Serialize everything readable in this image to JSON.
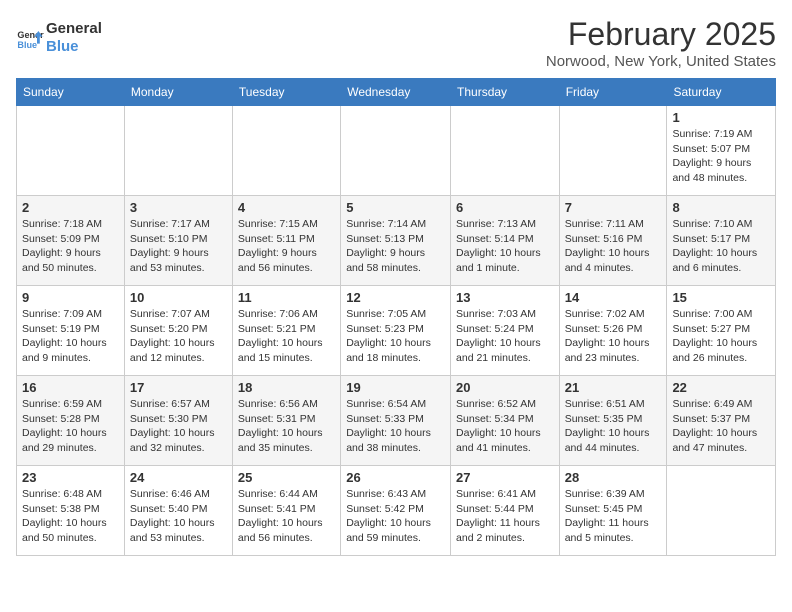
{
  "header": {
    "logo_text_general": "General",
    "logo_text_blue": "Blue",
    "main_title": "February 2025",
    "subtitle": "Norwood, New York, United States"
  },
  "days_of_week": [
    "Sunday",
    "Monday",
    "Tuesday",
    "Wednesday",
    "Thursday",
    "Friday",
    "Saturday"
  ],
  "weeks": [
    [
      {
        "day": "",
        "info": ""
      },
      {
        "day": "",
        "info": ""
      },
      {
        "day": "",
        "info": ""
      },
      {
        "day": "",
        "info": ""
      },
      {
        "day": "",
        "info": ""
      },
      {
        "day": "",
        "info": ""
      },
      {
        "day": "1",
        "info": "Sunrise: 7:19 AM\nSunset: 5:07 PM\nDaylight: 9 hours and 48 minutes."
      }
    ],
    [
      {
        "day": "2",
        "info": "Sunrise: 7:18 AM\nSunset: 5:09 PM\nDaylight: 9 hours and 50 minutes."
      },
      {
        "day": "3",
        "info": "Sunrise: 7:17 AM\nSunset: 5:10 PM\nDaylight: 9 hours and 53 minutes."
      },
      {
        "day": "4",
        "info": "Sunrise: 7:15 AM\nSunset: 5:11 PM\nDaylight: 9 hours and 56 minutes."
      },
      {
        "day": "5",
        "info": "Sunrise: 7:14 AM\nSunset: 5:13 PM\nDaylight: 9 hours and 58 minutes."
      },
      {
        "day": "6",
        "info": "Sunrise: 7:13 AM\nSunset: 5:14 PM\nDaylight: 10 hours and 1 minute."
      },
      {
        "day": "7",
        "info": "Sunrise: 7:11 AM\nSunset: 5:16 PM\nDaylight: 10 hours and 4 minutes."
      },
      {
        "day": "8",
        "info": "Sunrise: 7:10 AM\nSunset: 5:17 PM\nDaylight: 10 hours and 6 minutes."
      }
    ],
    [
      {
        "day": "9",
        "info": "Sunrise: 7:09 AM\nSunset: 5:19 PM\nDaylight: 10 hours and 9 minutes."
      },
      {
        "day": "10",
        "info": "Sunrise: 7:07 AM\nSunset: 5:20 PM\nDaylight: 10 hours and 12 minutes."
      },
      {
        "day": "11",
        "info": "Sunrise: 7:06 AM\nSunset: 5:21 PM\nDaylight: 10 hours and 15 minutes."
      },
      {
        "day": "12",
        "info": "Sunrise: 7:05 AM\nSunset: 5:23 PM\nDaylight: 10 hours and 18 minutes."
      },
      {
        "day": "13",
        "info": "Sunrise: 7:03 AM\nSunset: 5:24 PM\nDaylight: 10 hours and 21 minutes."
      },
      {
        "day": "14",
        "info": "Sunrise: 7:02 AM\nSunset: 5:26 PM\nDaylight: 10 hours and 23 minutes."
      },
      {
        "day": "15",
        "info": "Sunrise: 7:00 AM\nSunset: 5:27 PM\nDaylight: 10 hours and 26 minutes."
      }
    ],
    [
      {
        "day": "16",
        "info": "Sunrise: 6:59 AM\nSunset: 5:28 PM\nDaylight: 10 hours and 29 minutes."
      },
      {
        "day": "17",
        "info": "Sunrise: 6:57 AM\nSunset: 5:30 PM\nDaylight: 10 hours and 32 minutes."
      },
      {
        "day": "18",
        "info": "Sunrise: 6:56 AM\nSunset: 5:31 PM\nDaylight: 10 hours and 35 minutes."
      },
      {
        "day": "19",
        "info": "Sunrise: 6:54 AM\nSunset: 5:33 PM\nDaylight: 10 hours and 38 minutes."
      },
      {
        "day": "20",
        "info": "Sunrise: 6:52 AM\nSunset: 5:34 PM\nDaylight: 10 hours and 41 minutes."
      },
      {
        "day": "21",
        "info": "Sunrise: 6:51 AM\nSunset: 5:35 PM\nDaylight: 10 hours and 44 minutes."
      },
      {
        "day": "22",
        "info": "Sunrise: 6:49 AM\nSunset: 5:37 PM\nDaylight: 10 hours and 47 minutes."
      }
    ],
    [
      {
        "day": "23",
        "info": "Sunrise: 6:48 AM\nSunset: 5:38 PM\nDaylight: 10 hours and 50 minutes."
      },
      {
        "day": "24",
        "info": "Sunrise: 6:46 AM\nSunset: 5:40 PM\nDaylight: 10 hours and 53 minutes."
      },
      {
        "day": "25",
        "info": "Sunrise: 6:44 AM\nSunset: 5:41 PM\nDaylight: 10 hours and 56 minutes."
      },
      {
        "day": "26",
        "info": "Sunrise: 6:43 AM\nSunset: 5:42 PM\nDaylight: 10 hours and 59 minutes."
      },
      {
        "day": "27",
        "info": "Sunrise: 6:41 AM\nSunset: 5:44 PM\nDaylight: 11 hours and 2 minutes."
      },
      {
        "day": "28",
        "info": "Sunrise: 6:39 AM\nSunset: 5:45 PM\nDaylight: 11 hours and 5 minutes."
      },
      {
        "day": "",
        "info": ""
      }
    ]
  ]
}
